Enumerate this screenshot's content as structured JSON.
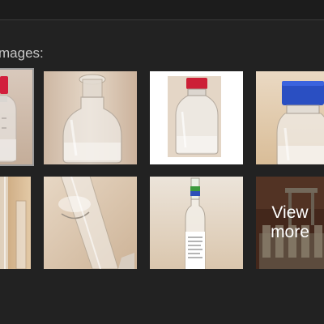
{
  "gallery": {
    "label": "mages:",
    "view_more": {
      "line1": "View",
      "line2": "more"
    },
    "thumbnails": [
      {
        "subject": "glass bottle with red cap",
        "selected": true
      },
      {
        "subject": "glass bottle with glass stopper",
        "selected": false
      },
      {
        "subject": "glass bottle with red cap on white background",
        "selected": false
      },
      {
        "subject": "glass bottle with blue cap",
        "selected": false
      },
      {
        "subject": "glass tubes",
        "selected": false
      },
      {
        "subject": "glass tube close-up",
        "selected": false
      },
      {
        "subject": "glass ampoule with label",
        "selected": false
      },
      {
        "subject": "rack of vials",
        "selected": false
      }
    ]
  }
}
